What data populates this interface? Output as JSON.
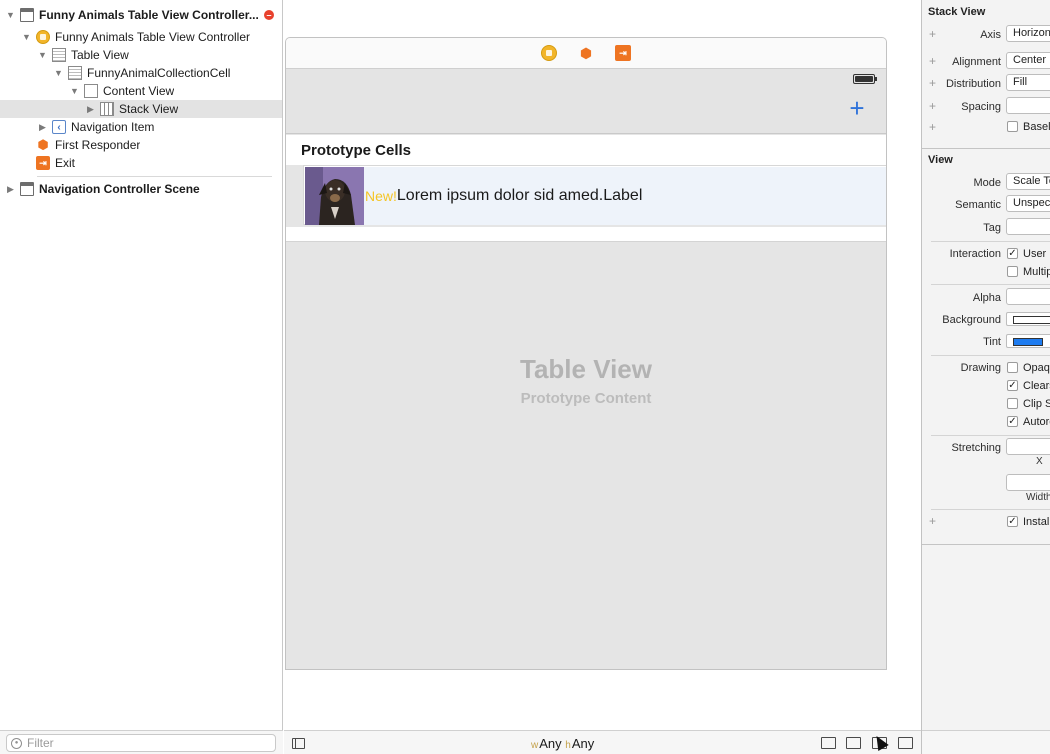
{
  "outline": {
    "items": [
      {
        "label": "Funny Animals Table View Controller...",
        "tri": "▼",
        "icon": "scene",
        "bold": true
      },
      {
        "label": "Funny Animals Table View Controller",
        "tri": "▼",
        "icon": "yellow",
        "bold": false
      },
      {
        "label": "Table View",
        "tri": "▼",
        "icon": "table",
        "bold": false
      },
      {
        "label": "FunnyAnimalCollectionCell",
        "tri": "▼",
        "icon": "table",
        "bold": false
      },
      {
        "label": "Content View",
        "tri": "▼",
        "icon": "content",
        "bold": false
      },
      {
        "label": "Stack View",
        "tri": "▶",
        "icon": "stack",
        "bold": false
      },
      {
        "label": "Navigation Item",
        "tri": "▶",
        "icon": "nav",
        "bold": false
      },
      {
        "label": "First Responder",
        "tri": "",
        "icon": "cube",
        "bold": false
      },
      {
        "label": "Exit",
        "tri": "",
        "icon": "exit",
        "bold": false
      },
      {
        "label": "Navigation Controller Scene",
        "tri": "▶",
        "icon": "scene",
        "bold": true
      }
    ],
    "filter_placeholder": "Filter"
  },
  "canvas": {
    "section_title": "Prototype Cells",
    "cell": {
      "badge": "New!",
      "label": "Lorem ipsum dolor sid amed.Label"
    },
    "placeholder_title": "Table View",
    "placeholder_subtitle": "Prototype Content",
    "add_glyph": "+"
  },
  "bottom_bar": {
    "w_prefix": "w",
    "w_value": "Any",
    "h_prefix": "h",
    "h_value": "Any"
  },
  "inspector": {
    "stack_header": "Stack View",
    "axis_label": "Axis",
    "axis_value": "Horizontal",
    "alignment_label": "Alignment",
    "alignment_value": "Center",
    "distribution_label": "Distribution",
    "distribution_value": "Fill",
    "spacing_label": "Spacing",
    "spacing_value": "",
    "baseline_text": "Baseline Relative Arrangement",
    "view_header": "View",
    "mode_label": "Mode",
    "mode_value": "Scale To Fill",
    "semantic_label": "Semantic",
    "semantic_value": "Unspecified",
    "tag_label": "Tag",
    "tag_value": "",
    "interaction_label": "Interaction",
    "user_interaction": "User Interaction Enabled",
    "multiple_touch": "Multiple Touch",
    "alpha_label": "Alpha",
    "alpha_value": "",
    "background_label": "Background",
    "tint_label": "Tint",
    "drawing_label": "Drawing",
    "opaque": "Opaque",
    "clears": "Clears Graphics Context",
    "clip": "Clip Subviews",
    "autoresize": "Autoresize Subviews",
    "stretching_label": "Stretching",
    "x_label": "X",
    "width_label": "Width",
    "installed": "Installed",
    "colors": {
      "tint": "#1e7cf0",
      "accent_add": "#2f73da",
      "new_badge": "#f4c526"
    }
  }
}
